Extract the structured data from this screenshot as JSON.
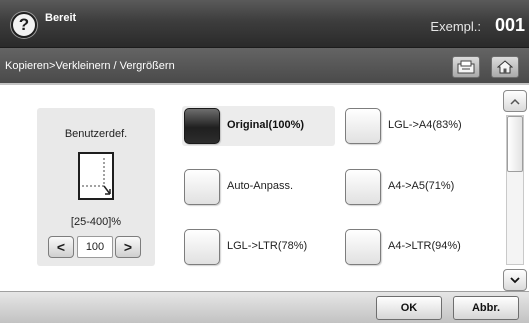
{
  "header": {
    "help_icon": "help-icon",
    "help_glyph": "?",
    "status": "Bereit",
    "copies_label": "Exempl.:",
    "copies_value": "001"
  },
  "breadcrumb": {
    "path": "Kopieren>Verkleinern / Vergrößern",
    "job_icon": "job-status-icon",
    "home_icon": "home-icon"
  },
  "custom": {
    "title": "Benutzerdef.",
    "range": "[25-400]%",
    "value": "100",
    "decrease_glyph": "<",
    "increase_glyph": ">"
  },
  "options": [
    {
      "label": "Original(100%)",
      "selected": true
    },
    {
      "label": "LGL->A4(83%)",
      "selected": false
    },
    {
      "label": "Auto-Anpass.",
      "selected": false
    },
    {
      "label": "A4->A5(71%)",
      "selected": false
    },
    {
      "label": "LGL->LTR(78%)",
      "selected": false
    },
    {
      "label": "A4->LTR(94%)",
      "selected": false
    }
  ],
  "footer": {
    "ok_label": "OK",
    "cancel_label": "Abbr."
  },
  "colors": {
    "header_bg": "#3d3d3d",
    "selected_option": "#2d2d2d",
    "panel_bg": "#e9e9e9"
  }
}
